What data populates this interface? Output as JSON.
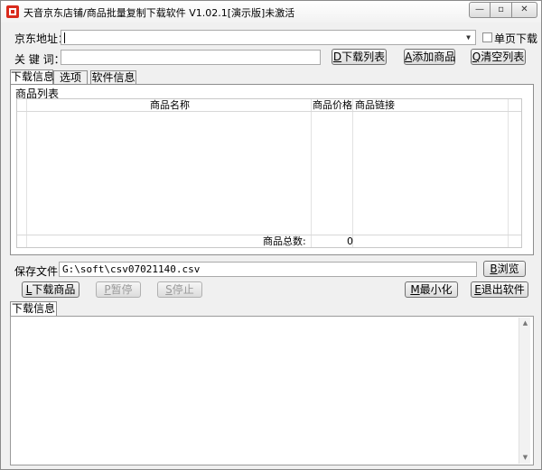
{
  "window": {
    "title": "天音京东店铺/商品批量复制下载软件 V1.02.1[演示版]未激活",
    "controls": {
      "minimize": "—",
      "maximize": "▫",
      "close": "✕"
    }
  },
  "form": {
    "url_label": "京东地址：",
    "url_value": "",
    "single_page_label": "单页下载",
    "keyword_label": "关 键 词：",
    "keyword_value": ""
  },
  "toolbar": {
    "download_list": {
      "key": "D",
      "label": "下载列表"
    },
    "add_product": {
      "key": "A",
      "label": "添加商品"
    },
    "clear_list": {
      "key": "Q",
      "label": "清空列表"
    }
  },
  "tabs": [
    "下载信息",
    "选项",
    "软件信息"
  ],
  "product_list": {
    "group_label": "商品列表",
    "columns": [
      "商品名称",
      "商品价格",
      "商品链接"
    ],
    "rows": [],
    "total_label": "商品总数:",
    "total_value": "0"
  },
  "save": {
    "label": "保存文件:",
    "path": "G:\\soft\\csv07021140.csv",
    "browse": {
      "key": "B",
      "label": "浏览"
    }
  },
  "actions": {
    "download_products": {
      "key": "L",
      "label": "下载商品"
    },
    "pause": {
      "key": "P",
      "label": "暂停"
    },
    "stop": {
      "key": "S",
      "label": "停止"
    },
    "minimize": {
      "key": "M",
      "label": "最小化"
    },
    "exit": {
      "key": "E",
      "label": "退出软件"
    }
  },
  "log": {
    "tab_label": "下载信息",
    "content": ""
  }
}
